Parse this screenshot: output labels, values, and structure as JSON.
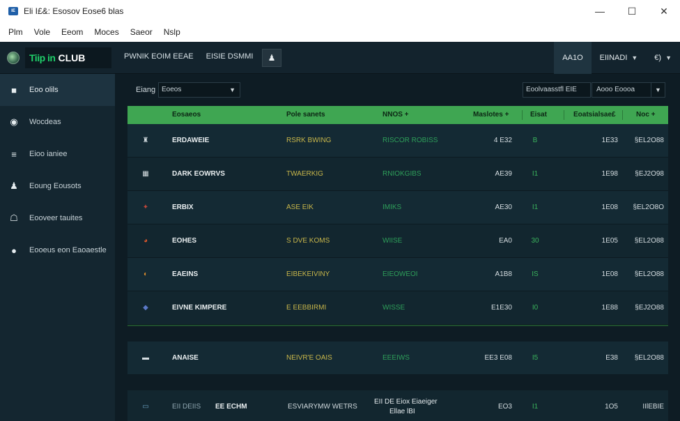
{
  "window": {
    "title": "Eli I£&: Esosov Eose6 blas",
    "app_icon_text": "IE",
    "controls": {
      "minimize": "—",
      "maximize": "☐",
      "close": "✕"
    }
  },
  "menu": [
    "Plm",
    "Vole",
    "Eeom",
    "Moces",
    "Saeor",
    "Nslp"
  ],
  "header": {
    "brand_badge": "Tiip in",
    "brand_name": "CLUB",
    "nav": [
      "PWNIK EOIM EEAE",
      "EISIE DSMMI"
    ],
    "right": [
      {
        "label": "AA1O",
        "caret": false
      },
      {
        "label": "EIINADI",
        "caret": true
      },
      {
        "label": "€)",
        "caret": true
      }
    ]
  },
  "sidebar": {
    "items": [
      {
        "label": "Eoo olils",
        "icon": "chat-icon",
        "glyph": "■",
        "active": true
      },
      {
        "label": "Wocdeas",
        "icon": "target-icon",
        "glyph": "◉",
        "active": false
      },
      {
        "label": "Eioo ianiee",
        "icon": "grid-icon",
        "glyph": "≡",
        "active": false
      },
      {
        "label": "Eoung Eousots",
        "icon": "person-icon",
        "glyph": "♟",
        "active": false
      },
      {
        "label": "Eooveer tauites",
        "icon": "building-icon",
        "glyph": "☖",
        "active": false
      },
      {
        "label": "Eooeus eon Eaoaestle",
        "icon": "info-icon",
        "glyph": "●",
        "active": false
      }
    ]
  },
  "filters": {
    "label": "Eiang",
    "select_value": "Eoeos",
    "sort_label": "Eoolvaasstfl EIE",
    "sort_value": "Aooo Eoooa"
  },
  "table": {
    "columns": [
      "Eosaeos",
      "Pole sanets",
      "NNOS +",
      "Maslotes +",
      "Eisat",
      "Eoatsialsae£",
      "Noc +"
    ],
    "rows": [
      {
        "icon": "jersey-icon",
        "glyph": "♜",
        "name": "ERDAWEIE",
        "type": "RSRK BWING",
        "team": "RISCOR ROBISS",
        "n1": "4 E32",
        "n2": "B",
        "n3": "1E33",
        "n4": "§EL2O88"
      },
      {
        "icon": "calculator-icon",
        "glyph": "▦",
        "name": "DARK EOWRVS",
        "type": "TWAERKIG",
        "team": "RNIOKGIBS",
        "n1": "AE39",
        "n2": "I1",
        "n3": "1E98",
        "n4": "§EJ2O98"
      },
      {
        "icon": "bull-icon",
        "glyph": "✦",
        "name": "ERBIX",
        "type": "ASE EIK",
        "team": "IMIKS",
        "n1": "AE30",
        "n2": "I1",
        "n3": "1E08",
        "n4": "§EL2O8O"
      },
      {
        "icon": "tomato-icon",
        "glyph": "◕",
        "name": "EOHES",
        "type": "S DVE KOMS",
        "team": "WIISE",
        "n1": "EA0",
        "n2": "30",
        "n3": "1E05",
        "n4": "§EL2O88"
      },
      {
        "icon": "ball-icon",
        "glyph": "◐",
        "name": "EAEINS",
        "type": "EIBEKEIVINY",
        "team": "EIEOWEOI",
        "n1": "A1B8",
        "n2": "IS",
        "n3": "1E08",
        "n4": "§EL2O88"
      },
      {
        "icon": "gem-icon",
        "glyph": "◆",
        "name": "EIVNE KIMPERE",
        "type": "E EEBBIRMI",
        "team": "WISSE",
        "n1": "E1E30",
        "n2": "I0",
        "n3": "1E88",
        "n4": "§EJ2O88"
      }
    ],
    "extra_rows": [
      {
        "icon": "bus-icon",
        "glyph": "▬",
        "name": "ANAISE",
        "type": "NEIVR'E OAIS",
        "team": "EEEIWS",
        "n1": "EE3 E08",
        "n2": "I5",
        "n3": "E38",
        "n4": "§EL2O88"
      },
      {
        "icon": "van-icon",
        "glyph": "▭",
        "name": "EII DEIIS",
        "name2": "EE ECHM",
        "type": "ESVIARYMW WETRS",
        "team": "EII DE Eiox Eiaeiger",
        "team2": "Ellae lBI",
        "n1": "EO3",
        "n2": "I1",
        "n3": "1O5",
        "n4": "IIlEBIE"
      }
    ]
  }
}
